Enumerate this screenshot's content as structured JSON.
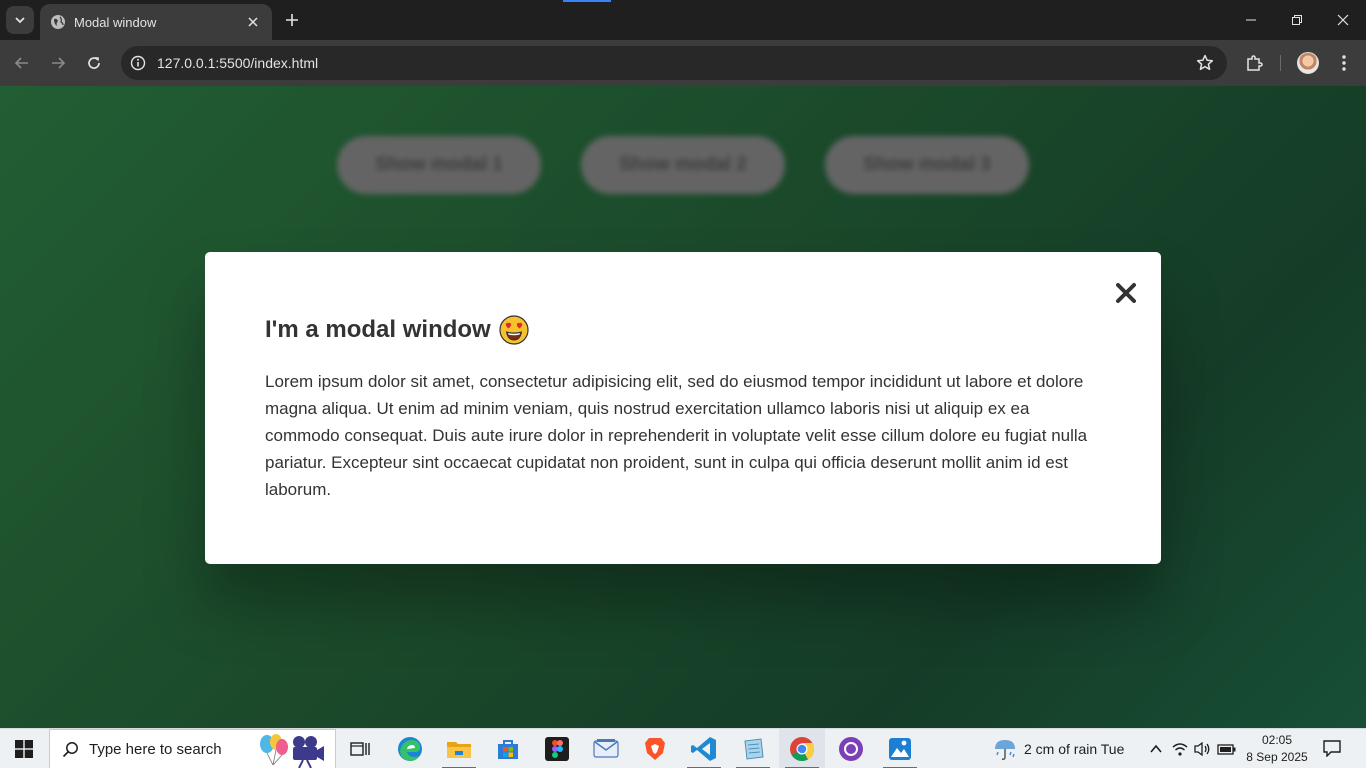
{
  "browser": {
    "tab": {
      "title": "Modal window",
      "favicon": "globe-icon"
    },
    "address": {
      "url": "127.0.0.1:5500/index.html"
    },
    "icons": [
      "tab-search-icon",
      "close-icon",
      "plus-icon",
      "back-arrow-icon",
      "forward-arrow-icon",
      "reload-icon",
      "site-info-icon",
      "star-icon",
      "extensions-icon",
      "kebab-menu-icon"
    ]
  },
  "page": {
    "buttons": [
      "Show modal 1",
      "Show modal 2",
      "Show modal 3"
    ]
  },
  "modal": {
    "title": "I'm a modal window",
    "emoji": "heart-eyes-emoji",
    "body": "Lorem ipsum dolor sit amet, consectetur adipisicing elit, sed do eiusmod tempor incididunt ut labore et dolore magna aliqua. Ut enim ad minim veniam, quis nostrud exercitation ullamco laboris nisi ut aliquip ex ea commodo consequat. Duis aute irure dolor in reprehenderit in voluptate velit esse cillum dolore eu fugiat nulla pariatur. Excepteur sint occaecat cupidatat non proident, sunt in culpa qui officia deserunt mollit anim id est laborum.",
    "close_icon": "close-x-icon"
  },
  "taskbar": {
    "search_placeholder": "Type here to search",
    "apps": [
      "task-view",
      "edge",
      "file-explorer",
      "microsoft-store",
      "figma",
      "mail",
      "brave",
      "vscode",
      "notepad",
      "chrome",
      "github-desktop",
      "photos"
    ],
    "weather": "2 cm of rain Tue",
    "time": "02:05",
    "date": "8 Sep 2025"
  },
  "colors": {
    "page_bg_start": "#2a733f",
    "page_bg_end": "#1a4a30",
    "modal_bg": "#ffffff",
    "text": "#333333"
  }
}
